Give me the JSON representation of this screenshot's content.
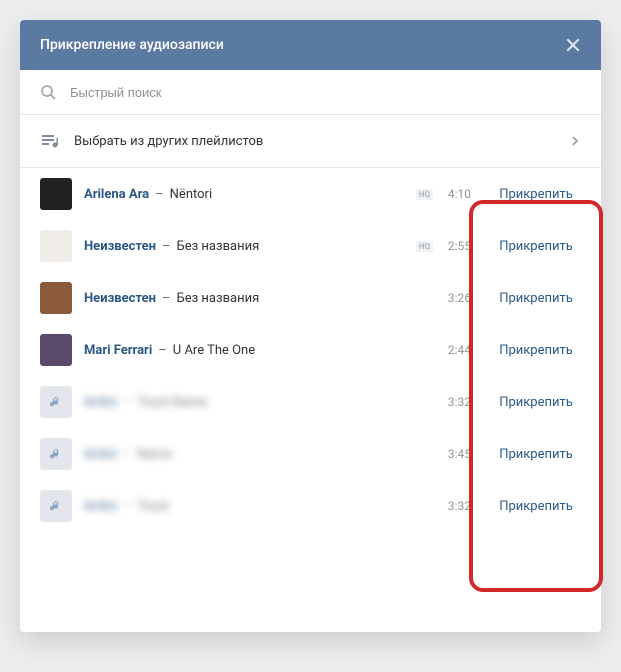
{
  "modal": {
    "title": "Прикрепление аудиозаписи"
  },
  "search": {
    "placeholder": "Быстрый поиск"
  },
  "playlist_selector": {
    "label": "Выбрать из других плейлистов"
  },
  "attach_label": "Прикрепить",
  "hq_label": "HQ",
  "tracks": [
    {
      "artist": "Arilena Ara",
      "title": "Nëntori",
      "duration": "4:10",
      "hq": true,
      "thumb": "dark",
      "blurred": false
    },
    {
      "artist": "Неизвестен",
      "title": "Без названия",
      "duration": "2:55",
      "hq": true,
      "thumb": "light",
      "blurred": false
    },
    {
      "artist": "Неизвестен",
      "title": "Без названия",
      "duration": "3:26",
      "hq": false,
      "thumb": "brown",
      "blurred": false
    },
    {
      "artist": "Mari Ferrari",
      "title": "U Are The One",
      "duration": "2:44",
      "hq": false,
      "thumb": "purple",
      "blurred": false
    },
    {
      "artist": "Artist",
      "title": "Track Name",
      "duration": "3:32",
      "hq": false,
      "thumb": "note",
      "blurred": true
    },
    {
      "artist": "Artist",
      "title": "Name",
      "duration": "3:45",
      "hq": false,
      "thumb": "note",
      "blurred": true
    },
    {
      "artist": "Artist",
      "title": "Track",
      "duration": "3:32",
      "hq": false,
      "thumb": "note",
      "blurred": true
    }
  ]
}
